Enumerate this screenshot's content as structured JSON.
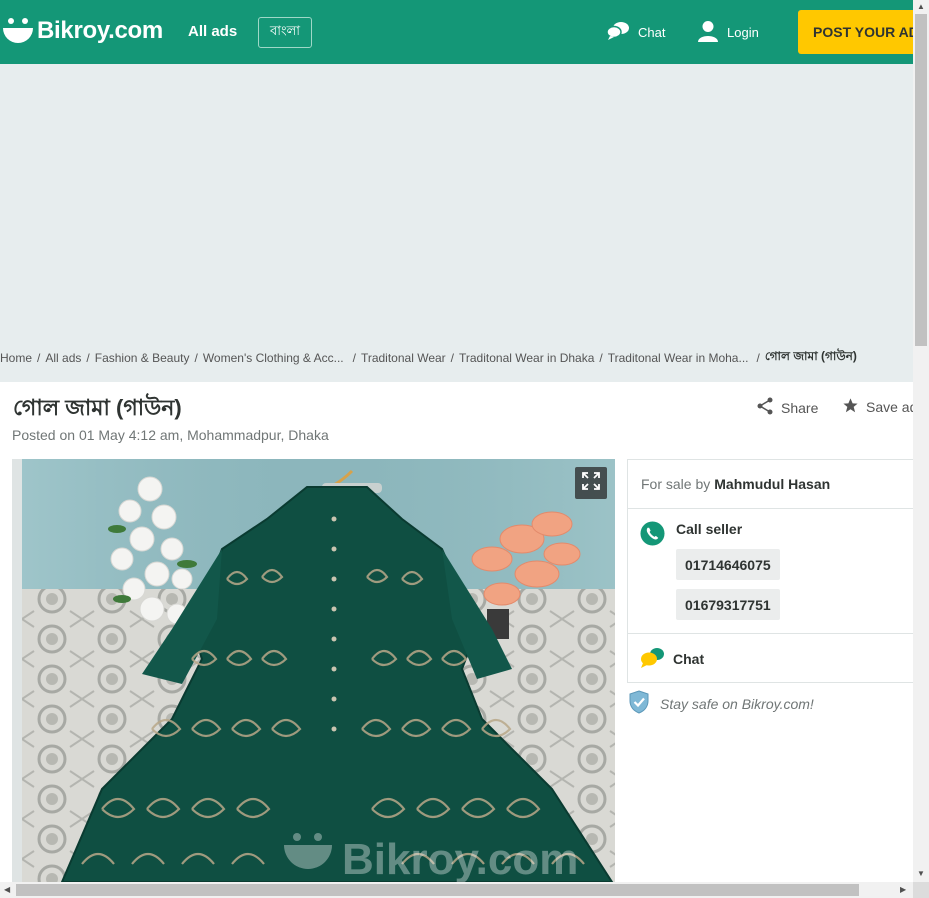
{
  "header": {
    "logo_text": "Bikroy.com",
    "nav_all_ads": "All ads",
    "language_button": "বাংলা",
    "chat_label": "Chat",
    "login_label": "Login",
    "post_ad_label": "POST YOUR AD",
    "brand_color": "#149777",
    "accent_color": "#ffc800"
  },
  "breadcrumb": {
    "items": [
      "Home",
      "All ads",
      "Fashion & Beauty",
      "Women's Clothing & Acc...",
      "Traditonal Wear",
      "Traditonal Wear in Dhaka",
      "Traditonal Wear in Moha..."
    ],
    "current": "গোল জামা (গাউন)"
  },
  "ad": {
    "title": "গোল জামা (গাউন)",
    "posted": "Posted on 01 May 4:12 am, Mohammadpur, Dhaka",
    "share_label": "Share",
    "save_label": "Save ad",
    "image_watermark": "Bikroy.com"
  },
  "seller": {
    "for_sale_by": "For sale by",
    "name": "Mahmudul Hasan",
    "call_label": "Call seller",
    "phones": [
      "01714646075",
      "01679317751"
    ],
    "chat_label": "Chat",
    "safety_text": "Stay safe on Bikroy.com!"
  }
}
